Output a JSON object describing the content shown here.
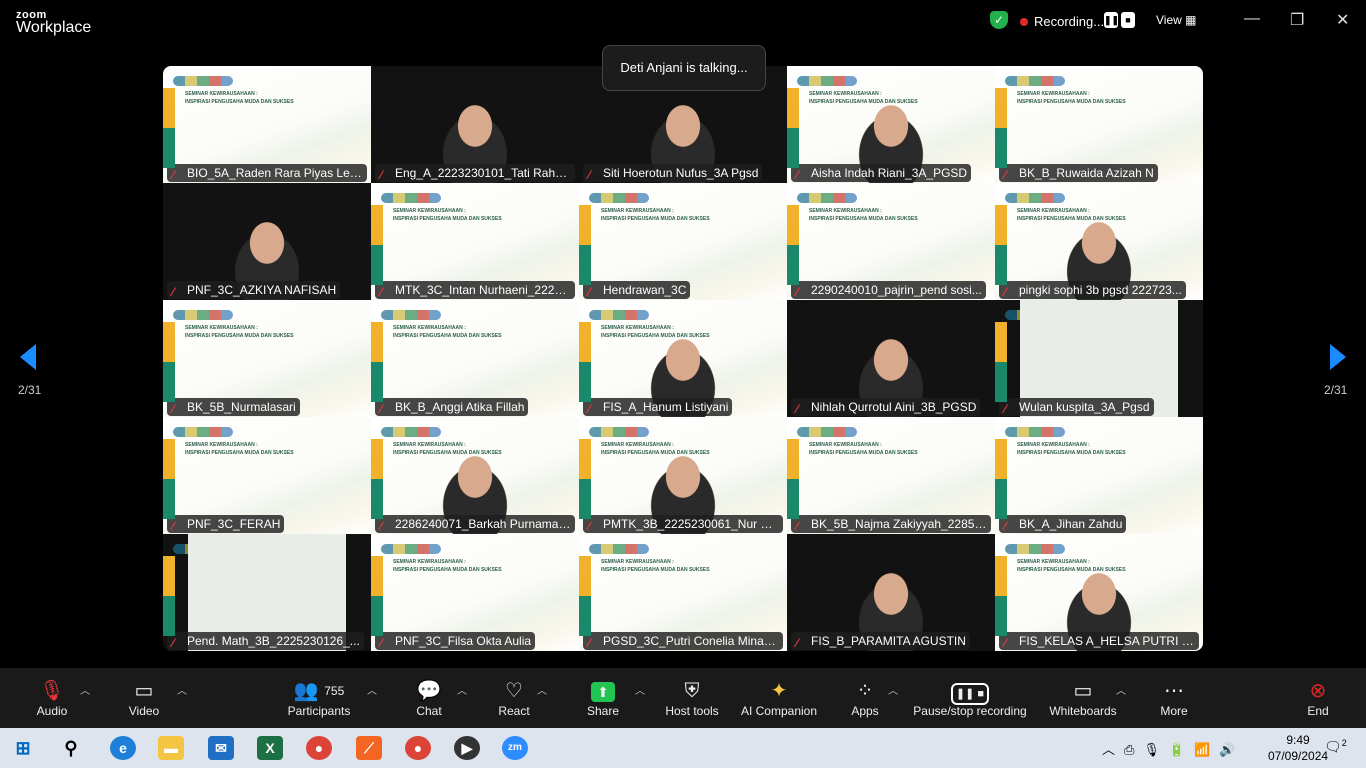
{
  "app": {
    "brand_top": "zoom",
    "brand_bottom": "Workplace",
    "recording": "Recording...",
    "view": "View"
  },
  "toast": "Deti Anjani is talking...",
  "pager": {
    "left": "2/31",
    "right": "2/31"
  },
  "slide_text": {
    "line1": "SEMINAR KEWIRAUSAHAAN :",
    "line2": "INSPIRASI PENGUSAHA MUDA DAN SUKSES"
  },
  "participants": [
    {
      "name": "BIO_5A_Raden Rara Piyas Leja...",
      "kind": "slide"
    },
    {
      "name": "Eng_A_2223230101_Tati Rahm...",
      "kind": "video"
    },
    {
      "name": "Siti Hoerotun Nufus_3A Pgsd",
      "kind": "video"
    },
    {
      "name": "Aisha Indah Riani_3A_PGSD",
      "kind": "slidevideo"
    },
    {
      "name": "BK_B_Ruwaida Azizah N",
      "kind": "slide"
    },
    {
      "name": "PNF_3C_AZKIYA NAFISAH",
      "kind": "video"
    },
    {
      "name": "MTK_3C_Intan Nurhaeni_2225...",
      "kind": "slide"
    },
    {
      "name": "Hendrawan_3C",
      "kind": "slide"
    },
    {
      "name": "2290240010_pajrin_pend sosi...",
      "kind": "slide"
    },
    {
      "name": "pingki sophi 3b pgsd 222723...",
      "kind": "slidevideo"
    },
    {
      "name": "BK_5B_Nurmalasari",
      "kind": "slide"
    },
    {
      "name": "BK_B_Anggi Atika Fillah",
      "kind": "slide"
    },
    {
      "name": "FIS_A_Hanum Listiyani",
      "kind": "slidevideo"
    },
    {
      "name": "Nihlah Qurrotul Aini_3B_PGSD",
      "kind": "video"
    },
    {
      "name": "Wulan kuspita_3A_Pgsd",
      "kind": "framed"
    },
    {
      "name": "PNF_3C_FERAH",
      "kind": "slide"
    },
    {
      "name": "2286240071_Barkah Purnama_...",
      "kind": "slidevideo"
    },
    {
      "name": "PMTK_3B_2225230061_Nur Fit...",
      "kind": "slidevideo"
    },
    {
      "name": "BK_5B_Najma Zakiyyah_22852...",
      "kind": "slide"
    },
    {
      "name": "BK_A_Jihan Zahdu",
      "kind": "slide"
    },
    {
      "name": "Pend. Math_3B_2225230126_...",
      "kind": "framed"
    },
    {
      "name": "PNF_3C_Filsa Okta Aulia",
      "kind": "slide"
    },
    {
      "name": "PGSD_3C_Putri Conelia Minan...",
      "kind": "slide"
    },
    {
      "name": "FIS_B_PARAMITA AGUSTIN",
      "kind": "video"
    },
    {
      "name": "FIS_KELAS A_HELSA PUTRI PR...",
      "kind": "slidevideo"
    }
  ],
  "toolbar": {
    "audio": "Audio",
    "video": "Video",
    "participants": "Participants",
    "participants_count": "755",
    "chat": "Chat",
    "react": "React",
    "share": "Share",
    "host_tools": "Host tools",
    "ai_companion": "AI Companion",
    "apps": "Apps",
    "pause_recording": "Pause/stop recording",
    "whiteboards": "Whiteboards",
    "more": "More",
    "end": "End"
  },
  "taskbar": {
    "time": "9:49",
    "date": "07/09/2024",
    "notifications": "2"
  },
  "colors": {
    "accent": "#1a8cff",
    "share": "#23c552",
    "end": "#e02828",
    "mic_muted": "#e8383d"
  }
}
